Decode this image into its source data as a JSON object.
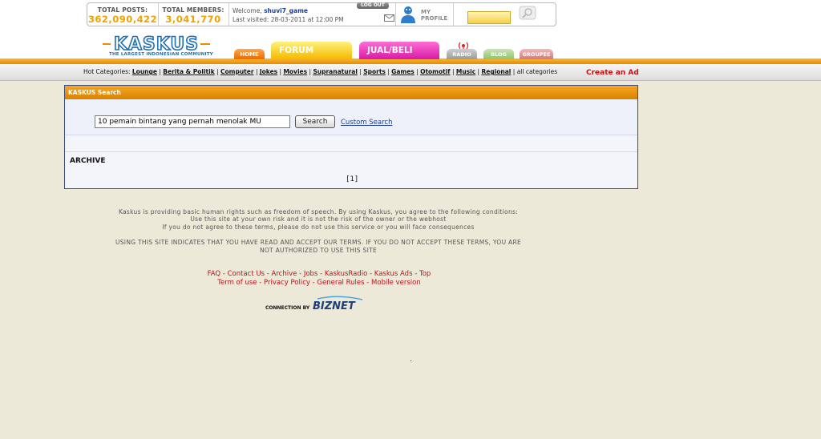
{
  "stats": {
    "total_posts_label": "TOTAL POSTS:",
    "total_posts": "362,090,422",
    "total_members_label": "TOTAL MEMBERS:",
    "total_members": "3,041,770"
  },
  "user": {
    "welcome": "Welcome,",
    "username": "shuvi7_game",
    "last_visited": "Last visited: 28-03-2011 at 12:00 PM",
    "logout": "LOG OUT",
    "my_profile_1": "MY",
    "my_profile_2": "PROFILE"
  },
  "logo": {
    "text": "KASKUS",
    "tagline": "THE LARGEST INDONESIAN COMMUNITY"
  },
  "nav": {
    "home": "HOME",
    "forum": "FORUM",
    "jual_beli": "JUAL/BELI",
    "radio": "RADIO",
    "blog": "BLOG",
    "groupee": "GROUPEE"
  },
  "categories": {
    "label": "Hot Categories:",
    "items": [
      "Lounge",
      "Berita & Politik",
      "Computer",
      "Jokes",
      "Movies",
      "Supranatural",
      "Sports",
      "Games",
      "Otomotif",
      "Music",
      "Regional"
    ],
    "all": "all categories",
    "create_ad": "Create an Ad"
  },
  "search": {
    "panel_title": "KASKUS Search",
    "query": "10 pemain bintang yang pernah menolak MU",
    "button": "Search",
    "custom": "Custom Search",
    "archive": "ARCHIVE",
    "page": "[1]"
  },
  "footer": {
    "line1": "Kaskus is providing basic human rights such as freedom of speech. By using Kaskus, you agree to the following conditions:",
    "line2": "Use this site at your own risk and it is not the risk of the owner or the webhost",
    "line3": "If you do not agree to these terms, please do not use this service or you will face consequences",
    "line4": "USING THIS SITE INDICATES THAT YOU HAVE READ AND ACCEPT OUR TERMS. IF YOU DO NOT ACCEPT THESE TERMS, YOU ARE",
    "line5": "NOT AUTHORIZED TO USE THIS SITE",
    "links_row1": [
      "FAQ",
      "Contact Us",
      "Archive",
      "Jobs",
      "KaskusRadio",
      "Kaskus Ads",
      "Top"
    ],
    "links_row2": [
      "Term of use",
      "Privacy Policy",
      "General Rules",
      "Mobile version"
    ],
    "connection_by": "CONNECTION BY",
    "biznet": "BIZNET"
  },
  "colors": {
    "accent_orange": "#f0a100",
    "nav_forum": "#f5b800",
    "nav_jual": "#d61aa5",
    "link_red": "#b8141c",
    "panel_border": "#3b4c84"
  }
}
